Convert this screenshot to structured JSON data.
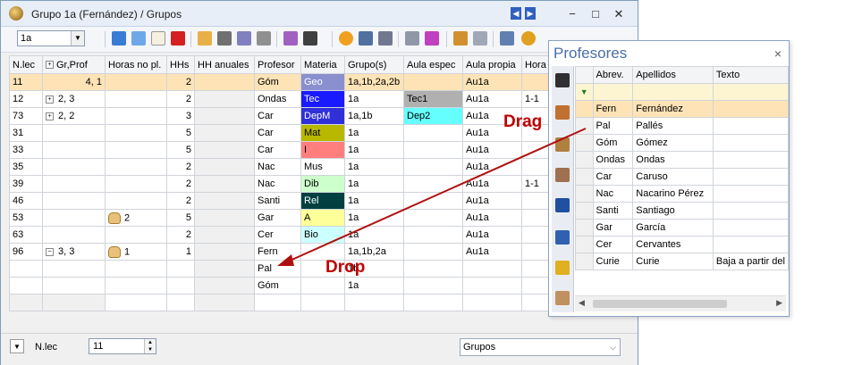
{
  "window": {
    "title": "Grupo 1a (Fernández) / Grupos",
    "nav_prev": "◀",
    "nav_next": "▶",
    "minimize": "−",
    "maximize": "□",
    "close": "✕"
  },
  "toolbar": {
    "class_combo_value": "1a",
    "icons": [
      "grid-view-icon",
      "list-icon",
      "new-icon",
      "delete-icon",
      "properties-icon",
      "filter-icon",
      "sort-icon",
      "link-icon",
      "magic-wand-icon",
      "graduate-icon",
      "clock-icon",
      "calendar-icon",
      "lookup-icon",
      "tree-icon",
      "stack-icon",
      "print-icon",
      "edit-icon",
      "settings-icon"
    ]
  },
  "grid": {
    "headers": [
      "N.lec",
      "Gr,Prof",
      "Horas no pl.",
      "HHs",
      "HH anuales",
      "Profesor",
      "Materia",
      "Grupo(s)",
      "Aula espec",
      "Aula propia",
      "Hora"
    ],
    "rows": [
      {
        "nlec": "11",
        "grprof": "4, 1",
        "horas": "",
        "hhs": "2",
        "hh": "",
        "prof": "Góm",
        "mat": "Geo",
        "mat_bg": "#8a8fd0",
        "mat_fg": "#ffffff",
        "grupo": "1a,1b,2a,2b",
        "aulae": "",
        "aulae_bg": "",
        "aulap": "Au1a",
        "hora": "",
        "selected": true,
        "expander": "",
        "hand": false
      },
      {
        "nlec": "12",
        "grprof": "2, 3",
        "horas": "",
        "hhs": "2",
        "hh": "",
        "prof": "Ondas",
        "mat": "Tec",
        "mat_bg": "#1a1aff",
        "mat_fg": "#ffffff",
        "grupo": "1a",
        "aulae": "Tec1",
        "aulae_bg": "#b0b0b0",
        "aulap": "Au1a",
        "hora": "1-1",
        "selected": false,
        "expander": "+",
        "hand": false
      },
      {
        "nlec": "73",
        "grprof": "2, 2",
        "horas": "",
        "hhs": "3",
        "hh": "",
        "prof": "Car",
        "mat": "DepM",
        "mat_bg": "#3030d8",
        "mat_fg": "#ffffff",
        "grupo": "1a,1b",
        "aulae": "Dep2",
        "aulae_bg": "#66ffff",
        "aulap": "Au1a",
        "hora": "",
        "selected": false,
        "expander": "+",
        "hand": false
      },
      {
        "nlec": "31",
        "grprof": "",
        "horas": "",
        "hhs": "5",
        "hh": "",
        "prof": "Car",
        "mat": "Mat",
        "mat_bg": "#b8b800",
        "mat_fg": "#000000",
        "grupo": "1a",
        "aulae": "",
        "aulae_bg": "",
        "aulap": "Au1a",
        "hora": "",
        "selected": false,
        "expander": "",
        "hand": false
      },
      {
        "nlec": "33",
        "grprof": "",
        "horas": "",
        "hhs": "5",
        "hh": "",
        "prof": "Car",
        "mat": "I",
        "mat_bg": "#ff7f7f",
        "mat_fg": "#000000",
        "grupo": "1a",
        "aulae": "",
        "aulae_bg": "",
        "aulap": "Au1a",
        "hora": "",
        "selected": false,
        "expander": "",
        "hand": false
      },
      {
        "nlec": "35",
        "grprof": "",
        "horas": "",
        "hhs": "2",
        "hh": "",
        "prof": "Nac",
        "mat": "Mus",
        "mat_bg": "#ffffff",
        "mat_fg": "#000000",
        "grupo": "1a",
        "aulae": "",
        "aulae_bg": "",
        "aulap": "Au1a",
        "hora": "",
        "selected": false,
        "expander": "",
        "hand": false
      },
      {
        "nlec": "39",
        "grprof": "",
        "horas": "",
        "hhs": "2",
        "hh": "",
        "prof": "Nac",
        "mat": "Dib",
        "mat_bg": "#ccffcc",
        "mat_fg": "#000000",
        "grupo": "1a",
        "aulae": "",
        "aulae_bg": "",
        "aulap": "Au1a",
        "hora": "1-1",
        "selected": false,
        "expander": "",
        "hand": false
      },
      {
        "nlec": "46",
        "grprof": "",
        "horas": "",
        "hhs": "2",
        "hh": "",
        "prof": "Santi",
        "mat": "Rel",
        "mat_bg": "#004040",
        "mat_fg": "#ffffff",
        "grupo": "1a",
        "aulae": "",
        "aulae_bg": "",
        "aulap": "Au1a",
        "hora": "",
        "selected": false,
        "expander": "",
        "hand": false
      },
      {
        "nlec": "53",
        "grprof": "",
        "horas": "2",
        "hhs": "5",
        "hh": "",
        "prof": "Gar",
        "mat": "A",
        "mat_bg": "#ffff99",
        "mat_fg": "#000000",
        "grupo": "1a",
        "aulae": "",
        "aulae_bg": "",
        "aulap": "Au1a",
        "hora": "",
        "selected": false,
        "expander": "",
        "hand": true
      },
      {
        "nlec": "63",
        "grprof": "",
        "horas": "",
        "hhs": "2",
        "hh": "",
        "prof": "Cer",
        "mat": "Bio",
        "mat_bg": "#ccffff",
        "mat_fg": "#000000",
        "grupo": "1a",
        "aulae": "",
        "aulae_bg": "",
        "aulap": "Au1a",
        "hora": "",
        "selected": false,
        "expander": "",
        "hand": false
      },
      {
        "nlec": "96",
        "grprof": "3, 3",
        "horas": "1",
        "hhs": "1",
        "hh": "",
        "prof": "Fern",
        "mat": "",
        "mat_bg": "#ffffff",
        "mat_fg": "#000000",
        "grupo": "1a,1b,2a",
        "aulae": "",
        "aulae_bg": "",
        "aulap": "Au1a",
        "hora": "",
        "selected": false,
        "expander": "−",
        "hand": true
      },
      {
        "nlec": "",
        "grprof": "",
        "horas": "",
        "hhs": "",
        "hh": "",
        "prof": "Pal",
        "mat": "",
        "mat_bg": "#ffffff",
        "mat_fg": "#000000",
        "grupo": "1b",
        "aulae": "",
        "aulae_bg": "",
        "aulap": "",
        "hora": "",
        "selected": false,
        "expander": "",
        "hand": false
      },
      {
        "nlec": "",
        "grprof": "",
        "horas": "",
        "hhs": "",
        "hh": "",
        "prof": "Góm",
        "mat": "",
        "mat_bg": "#ffffff",
        "mat_fg": "#000000",
        "grupo": "1a",
        "aulae": "",
        "aulae_bg": "",
        "aulap": "",
        "hora": "",
        "selected": false,
        "expander": "",
        "hand": false
      }
    ]
  },
  "statusbar": {
    "field_label": "N.lec",
    "field_value": "11",
    "view_select": "Grupos",
    "dropdown_glyph": "▼"
  },
  "profesores": {
    "title": "Profesores",
    "close": "×",
    "headers": [
      "Abrev.",
      "Apellidos",
      "Texto"
    ],
    "rows": [
      {
        "abrev": "Fern",
        "apellidos": "Fernández",
        "texto": "",
        "selected": true
      },
      {
        "abrev": "Pal",
        "apellidos": "Pallés",
        "texto": "",
        "selected": false
      },
      {
        "abrev": "Góm",
        "apellidos": "Gómez",
        "texto": "",
        "selected": false
      },
      {
        "abrev": "Ondas",
        "apellidos": "Ondas",
        "texto": "",
        "selected": false
      },
      {
        "abrev": "Car",
        "apellidos": "Caruso",
        "texto": "",
        "selected": false
      },
      {
        "abrev": "Nac",
        "apellidos": "Nacarino Pérez",
        "texto": "",
        "selected": false
      },
      {
        "abrev": "Santi",
        "apellidos": "Santiago",
        "texto": "",
        "selected": false
      },
      {
        "abrev": "Gar",
        "apellidos": "García",
        "texto": "",
        "selected": false
      },
      {
        "abrev": "Cer",
        "apellidos": "Cervantes",
        "texto": "",
        "selected": false
      },
      {
        "abrev": "Curie",
        "apellidos": "Curie",
        "texto": "Baja a partir del",
        "selected": false
      }
    ]
  },
  "annotations": {
    "drag": "Drag",
    "drop": "Drop",
    "arrow_color": "#b01010"
  }
}
